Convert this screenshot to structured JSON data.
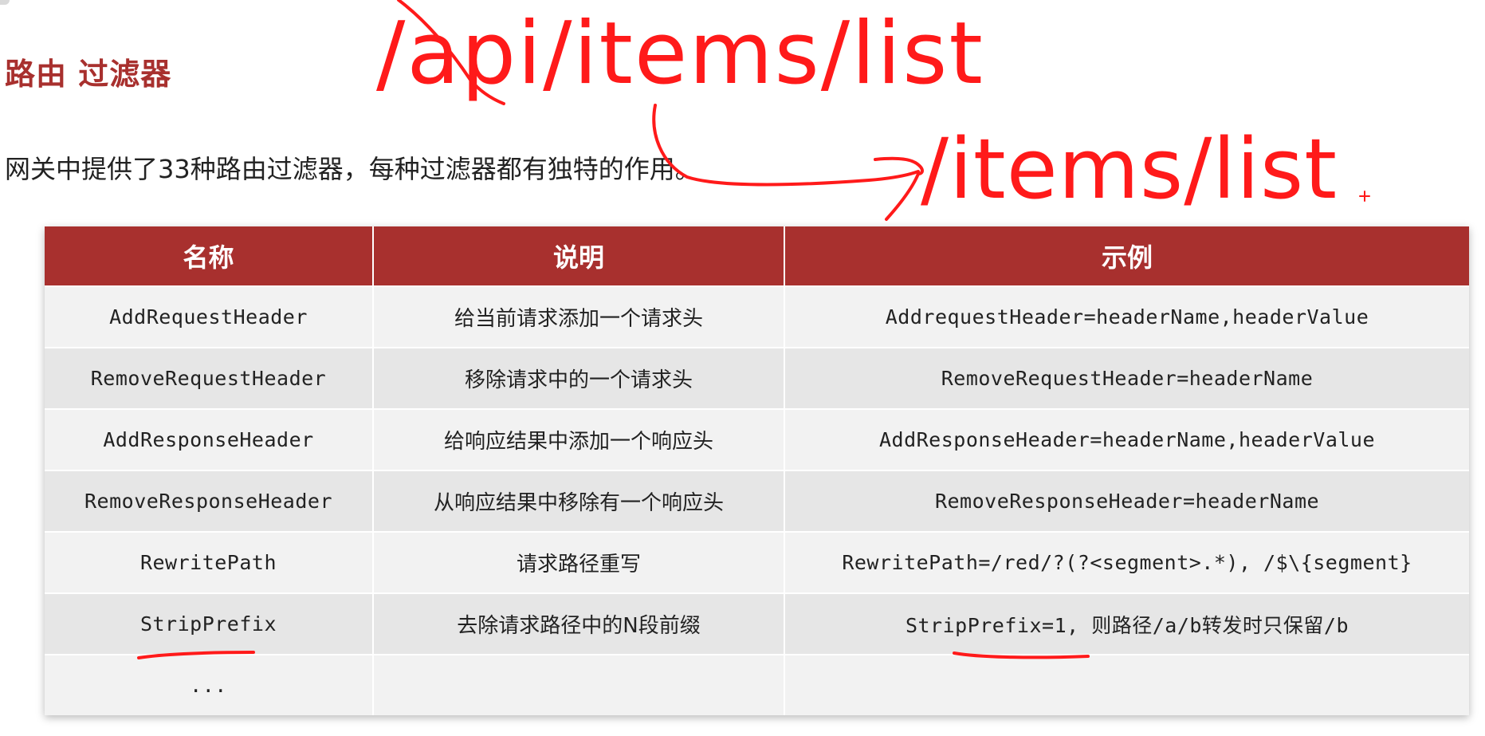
{
  "page": {
    "title": "路由 过滤器",
    "subtitle": "网关中提供了33种路由过滤器，每种过滤器都有独特的作用。"
  },
  "annotations": {
    "api_path": "/api/items/list",
    "target_path": "/items/list",
    "color": "#ff1a1a"
  },
  "table": {
    "header_color": "#a8302e",
    "columns": [
      "名称",
      "说明",
      "示例"
    ],
    "rows": [
      {
        "name": "AddRequestHeader",
        "description": "给当前请求添加一个请求头",
        "example": "AddrequestHeader=headerName,headerValue"
      },
      {
        "name": "RemoveRequestHeader",
        "description": "移除请求中的一个请求头",
        "example": "RemoveRequestHeader=headerName"
      },
      {
        "name": "AddResponseHeader",
        "description": "给响应结果中添加一个响应头",
        "example": "AddResponseHeader=headerName,headerValue"
      },
      {
        "name": "RemoveResponseHeader",
        "description": "从响应结果中移除有一个响应头",
        "example": "RemoveResponseHeader=headerName"
      },
      {
        "name": "RewritePath",
        "description": "请求路径重写",
        "example": "RewritePath=/red/?(?<segment>.*), /$\\{segment}"
      },
      {
        "name": "StripPrefix",
        "description": "去除请求路径中的N段前缀",
        "example": "StripPrefix=1, 则路径/a/b转发时只保留/b"
      },
      {
        "name": "...",
        "description": "",
        "example": ""
      }
    ]
  }
}
